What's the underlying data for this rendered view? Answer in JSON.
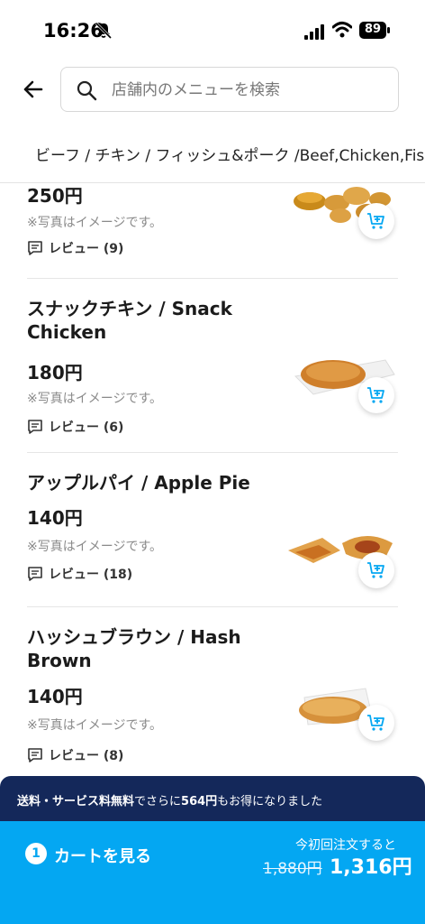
{
  "status_bar": {
    "time": "16:26",
    "battery": "89"
  },
  "header": {
    "search_placeholder": "店舗内のメニューを検索"
  },
  "category_tab": "ビーフ / チキン / フィッシュ&ポーク /Beef,Chicken,Fish",
  "items": [
    {
      "name": "",
      "price": "250円",
      "note": "※写真はイメージです。",
      "reviews": "レビュー (9)"
    },
    {
      "name": "スナックチキン / Snack Chicken",
      "price": "180円",
      "note": "※写真はイメージです。",
      "reviews": "レビュー (6)"
    },
    {
      "name": "アップルパイ / Apple Pie",
      "price": "140円",
      "note": "※写真はイメージです。",
      "reviews": "レビュー (18)"
    },
    {
      "name": "ハッシュブラウン / Hash Brown",
      "price": "140円",
      "note": "※写真はイメージです。",
      "reviews": "レビュー (8)"
    }
  ],
  "promo": {
    "prefix": "送料・サービス料無料",
    "middle": "でさらに",
    "amount": "564円",
    "suffix": "もお得になりました"
  },
  "cart": {
    "count": "1",
    "label": "カートを見る",
    "first_order_label": "今初回注文すると",
    "old_price": "1,880円",
    "new_price": "1,316円"
  },
  "colors": {
    "accent": "#04a7f2",
    "promo_bg": "#14285a"
  }
}
